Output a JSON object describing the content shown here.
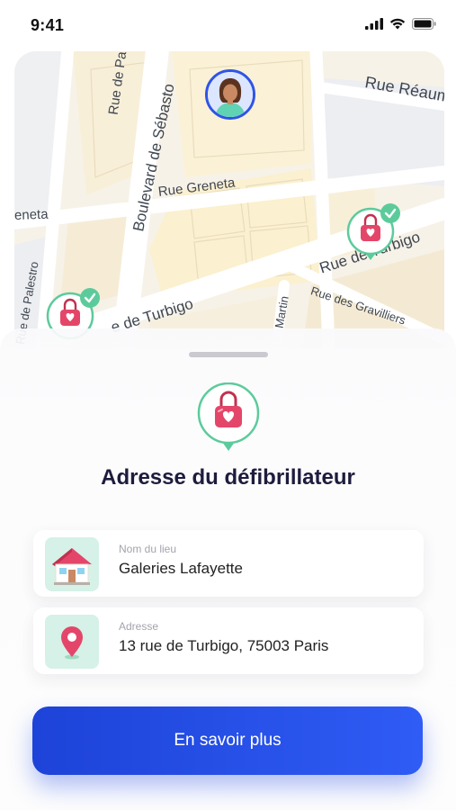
{
  "status_bar": {
    "time": "9:41"
  },
  "map": {
    "streets": {
      "palestro_top": "Rue de Pal",
      "sebastopol": "Boulevard de Sébasto",
      "reaumur": "Rue Réaum",
      "greneta_center": "Rue Greneta",
      "greneta_left": "eneta",
      "turbigo_right": "Rue de Turbigo",
      "palestro_bottom": "Rue de Palestro",
      "turbigo_bottom": "e de Turbigo",
      "martin": "Martin",
      "gravilliers": "Rue des Gravilliers"
    }
  },
  "sheet": {
    "title": "Adresse du défibrillateur",
    "place": {
      "label": "Nom du lieu",
      "value": "Galeries Lafayette"
    },
    "address": {
      "label": "Adresse",
      "value": "13 rue de Turbigo, 75003 Paris"
    },
    "cta_label": "En savoir plus"
  },
  "colors": {
    "primary": "#2f54e6",
    "accent_green": "#5ccb9b",
    "marker_pink": "#e4466a",
    "icon_bg": "#d6f1e7"
  },
  "icons": {
    "place_icon": "building-icon",
    "address_icon": "location-pin-icon",
    "marker": "defibrillator-bag-icon",
    "check": "check-icon"
  }
}
